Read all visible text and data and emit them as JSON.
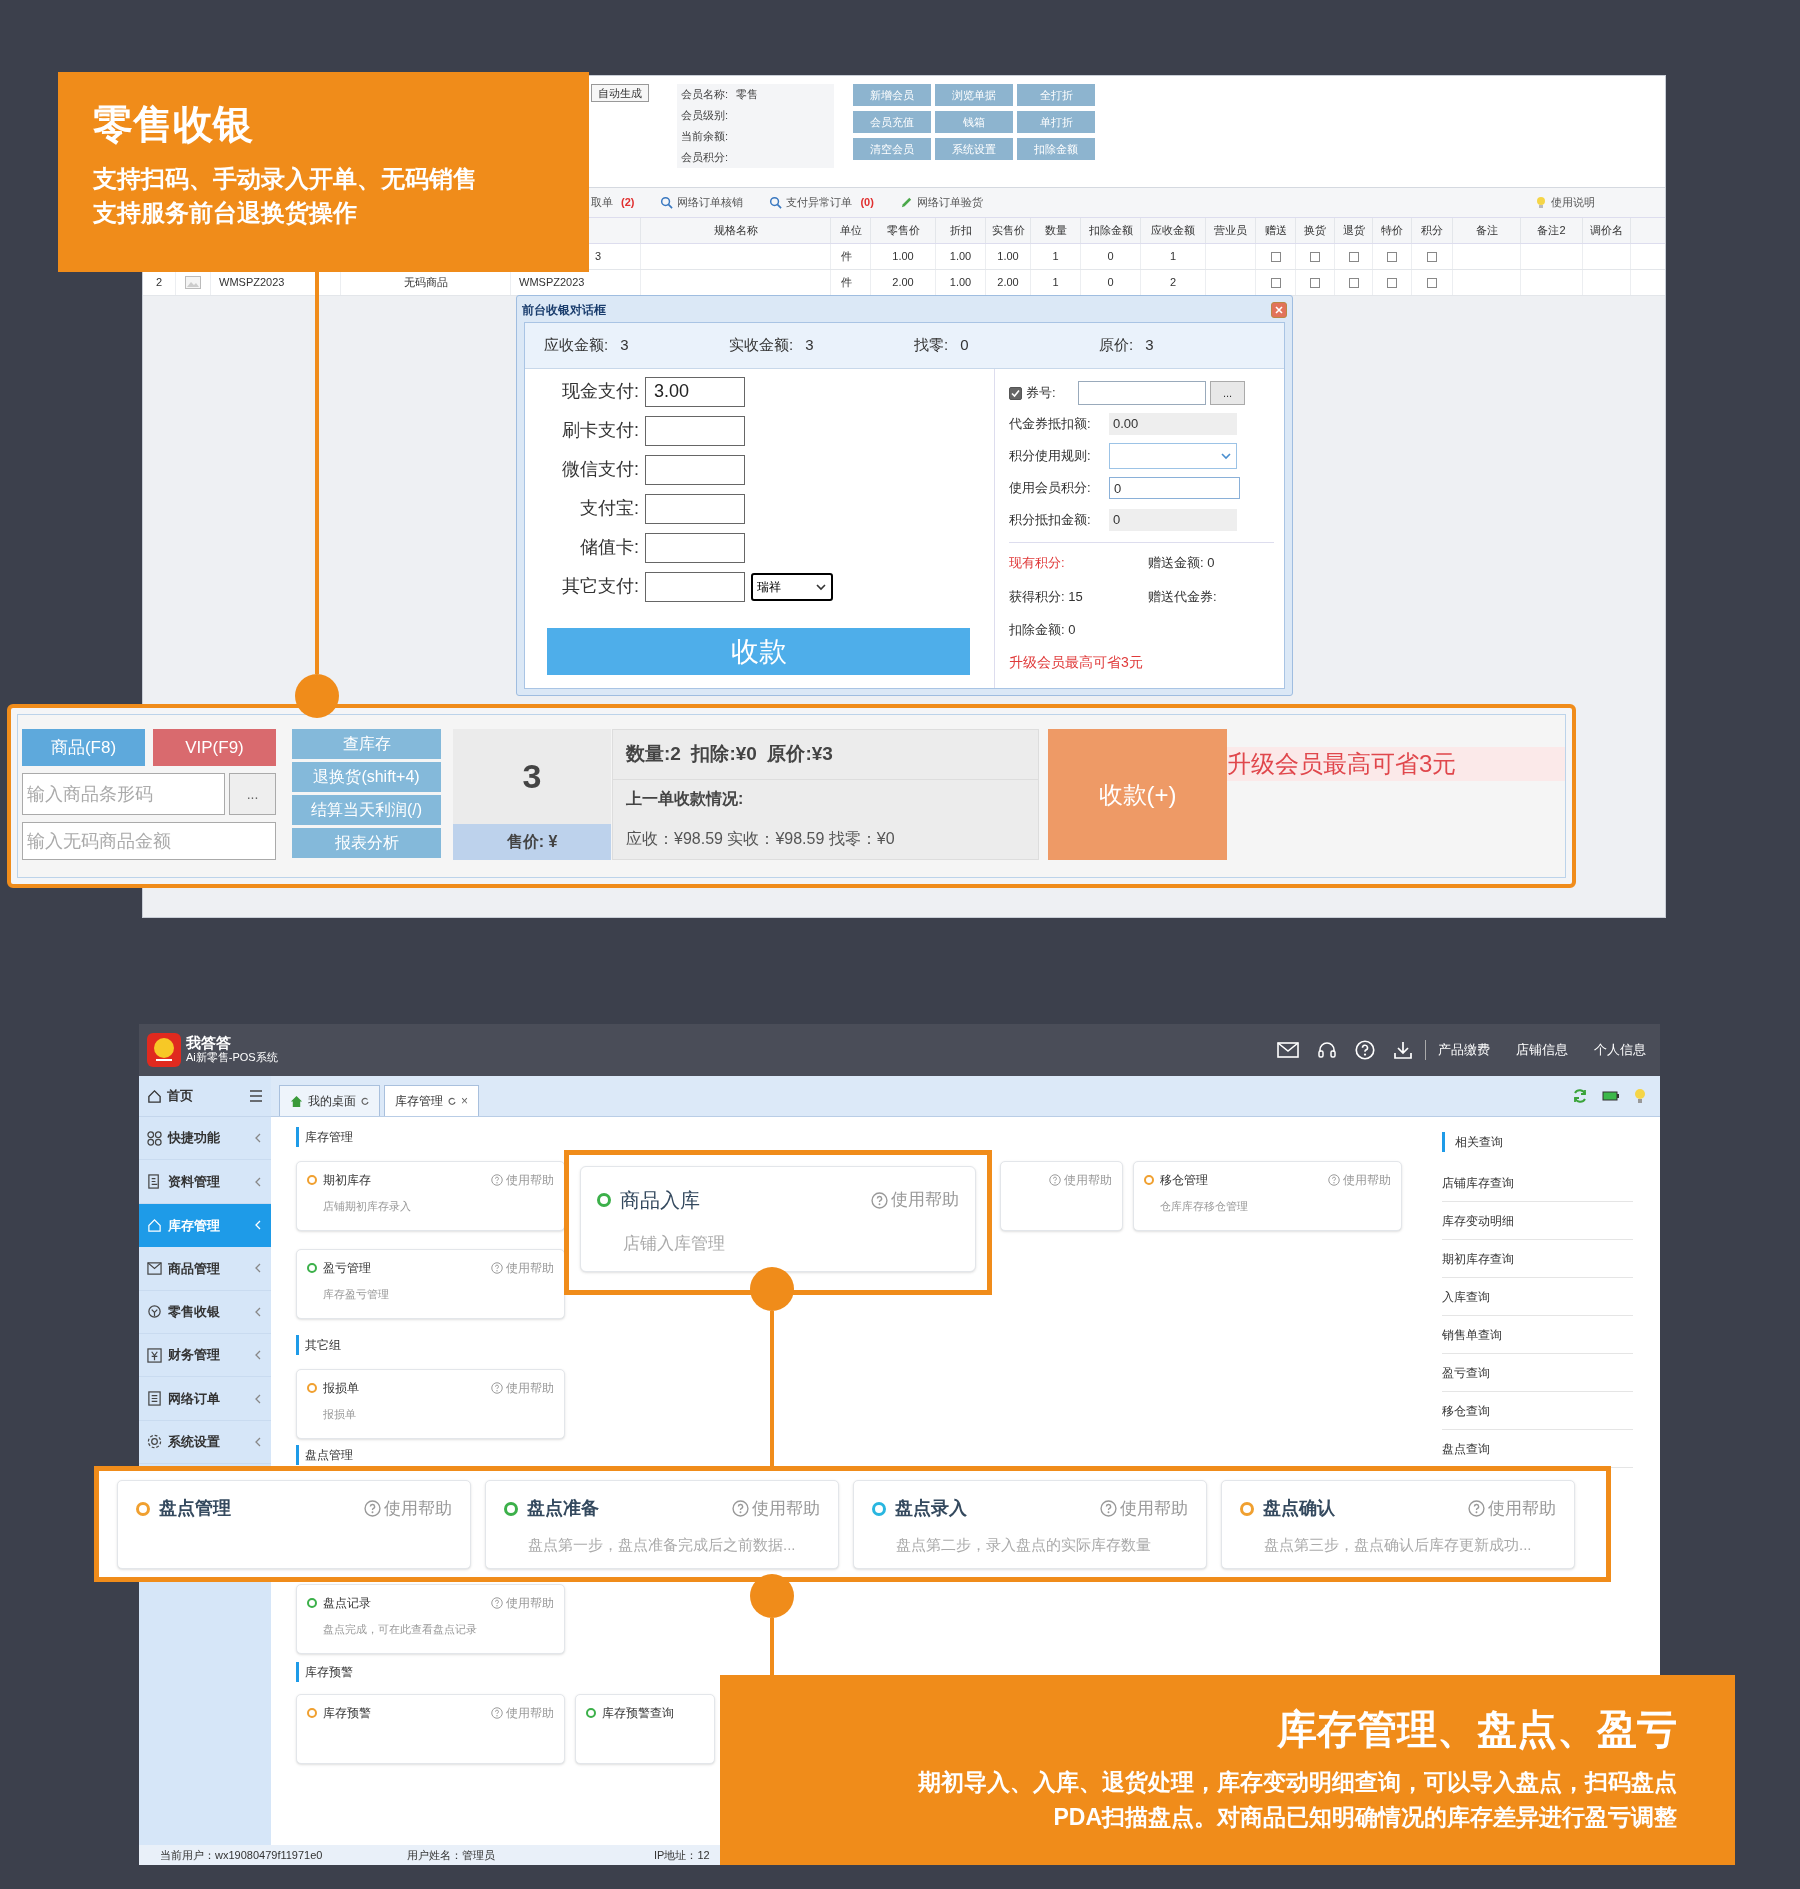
{
  "retail_callout": {
    "title": "零售收银",
    "lines": [
      "支持扫码、手动录入开单、无码销售",
      "支持服务前台退换货操作"
    ]
  },
  "pos_window": {
    "order_button": "自动生成",
    "member_info": [
      {
        "label": "会员名称:",
        "value": "零售"
      },
      {
        "label": "会员级别:"
      },
      {
        "label": "当前余额:"
      },
      {
        "label": "会员积分:"
      }
    ],
    "member_buttons": [
      "新增会员",
      "浏览单据",
      "全打折",
      "会员充值",
      "钱箱",
      "单打折",
      "清空会员",
      "系统设置",
      "扣除金额"
    ],
    "toolbar": [
      {
        "kind": "plain",
        "label": "取单",
        "count": "(2)"
      },
      {
        "kind": "search",
        "label": "网络订单核销"
      },
      {
        "kind": "search",
        "label": "支付异常订单",
        "count": "(0)"
      },
      {
        "kind": "edit",
        "label": "网络订单验货"
      }
    ],
    "help_link": "使用说明",
    "table": {
      "columns": [
        "规格名称",
        "单位",
        "零售价",
        "折扣",
        "实售价",
        "数量",
        "扣除金额",
        "应收金额",
        "营业员",
        "赠送",
        "换货",
        "退货",
        "特价",
        "积分",
        "备注",
        "备注2",
        "调价名"
      ],
      "rows": [
        {
          "barcode": "3",
          "unit": "件",
          "values": [
            "1.00",
            "1.00",
            "1.00",
            "1",
            "0",
            "1"
          ],
          "checks": [
            false,
            false,
            false,
            false,
            false
          ]
        },
        {
          "no": "2",
          "has_image": true,
          "code": "WMSPZ2023",
          "name": "无码商品",
          "barcode": "WMSPZ2023",
          "unit": "件",
          "values": [
            "2.00",
            "1.00",
            "2.00",
            "1",
            "0",
            "2"
          ],
          "checks": [
            false,
            false,
            false,
            false,
            false
          ]
        }
      ]
    }
  },
  "dialog": {
    "title": "前台收银对话框",
    "summary": [
      {
        "label": "应收金额:",
        "value": "3"
      },
      {
        "label": "实收金额:",
        "value": "3"
      },
      {
        "label": "找零:",
        "value": "0"
      },
      {
        "label": "原价:",
        "value": "3"
      }
    ],
    "payments": [
      {
        "label": "现金支付:",
        "value": "3.00"
      },
      {
        "label": "刷卡支付:"
      },
      {
        "label": "微信支付:"
      },
      {
        "label": "支付宝:"
      },
      {
        "label": "储值卡:"
      },
      {
        "label": "其它支付:",
        "option": "瑞祥"
      }
    ],
    "pay_button": "收款",
    "voucher": {
      "checked": true,
      "label": "券号:",
      "browse": "..."
    },
    "fields": [
      {
        "kind": "readonly",
        "label": "代金券抵扣额:",
        "value": "0.00"
      },
      {
        "kind": "select",
        "label": "积分使用规则:"
      },
      {
        "kind": "input",
        "label": "使用会员积分:",
        "value": "0"
      },
      {
        "kind": "readonly",
        "label": "积分抵扣金额:",
        "value": "0"
      }
    ],
    "stats": [
      {
        "text": "现有积分:",
        "highlight": true
      },
      {
        "text": "赠送金额: 0",
        "highlight": false
      },
      {
        "text": "获得积分: 15",
        "highlight": false
      },
      {
        "text": "赠送代金券:",
        "highlight": false
      },
      {
        "text": "扣除金额: 0",
        "highlight": false
      }
    ],
    "promo": "升级会员最高可省3元"
  },
  "checkout_bar": {
    "product_button": "商品(F8)",
    "vip_button": "VIP(F9)",
    "barcode_placeholder": "输入商品条形码",
    "browse": "...",
    "amount_placeholder": "输入无码商品金额",
    "actions": [
      "查库存",
      "退换货(shift+4)",
      "结算当天利润(/)",
      "报表分析"
    ],
    "quantity": "3",
    "price_label": "售价: ¥",
    "summary": "数量:2  扣除:¥0  原价:¥3",
    "last_title": "上一单收款情况:",
    "last_detail": "应收：¥98.59 实收：¥98.59 找零：¥0",
    "checkout_button": "收款(+)",
    "promo": "升级会员最高可省3元"
  },
  "inventory_app": {
    "name": "我答答",
    "subtitle": "Ai新零售-POS系统",
    "header_links": [
      "产品缴费",
      "店铺信息",
      "个人信息"
    ],
    "home": "首页",
    "tabs": [
      {
        "kind": "home",
        "label": "我的桌面",
        "selected": false
      },
      {
        "kind": "page",
        "label": "库存管理",
        "selected": true,
        "close": "×"
      }
    ],
    "sidebar": [
      {
        "label": "快捷功能",
        "selected": false
      },
      {
        "label": "资料管理",
        "selected": false
      },
      {
        "label": "库存管理",
        "selected": true
      },
      {
        "label": "商品管理",
        "selected": false
      },
      {
        "label": "零售收银",
        "selected": false
      },
      {
        "label": "财务管理",
        "selected": false
      },
      {
        "label": "网络订单",
        "selected": false
      },
      {
        "label": "系统设置",
        "selected": false
      }
    ],
    "sections": [
      {
        "title": "库存管理",
        "cards": [
          {
            "kind": "full",
            "title": "期初库存",
            "desc": "店铺期初库存录入",
            "color": "#f0a030",
            "help": "使用帮助"
          },
          {
            "kind": "partial",
            "help": "使用帮助"
          },
          {
            "kind": "full",
            "title": "移仓管理",
            "desc": "仓库库存移仓管理",
            "color": "#f0a030",
            "help": "使用帮助"
          },
          {
            "kind": "full",
            "title": "盈亏管理",
            "desc": "库存盈亏管理",
            "color": "#3cb04a",
            "help": "使用帮助"
          }
        ]
      },
      {
        "title": "其它组",
        "cards": [
          {
            "kind": "full",
            "title": "报损单",
            "desc": "报损单",
            "color": "#f0a030",
            "help": "使用帮助"
          }
        ]
      },
      {
        "title": "盘点管理",
        "cards": [
          {
            "kind": "full",
            "title": "盘点记录",
            "desc": "盘点完成，可在此查看盘点记录",
            "color": "#3cb04a",
            "help": "使用帮助"
          }
        ]
      },
      {
        "title": "库存预警",
        "cards": [
          {
            "kind": "full",
            "title": "库存预警",
            "color": "#f0a030",
            "help": "使用帮助"
          },
          {
            "kind": "clipped",
            "title": "库存预警查询",
            "color": "#3cb04a"
          }
        ]
      }
    ],
    "related": {
      "title": "相关查询",
      "links": [
        "店铺库存查询",
        "库存变动明细",
        "期初库存查询",
        "入库查询",
        "销售单查询",
        "盈亏查询",
        "移仓查询",
        "盘点查询"
      ]
    },
    "status_bar": [
      "当前用户：wx19080479f11971e0",
      "用户姓名：管理员",
      "IP地址：12"
    ]
  },
  "inventory_callouts": {
    "main_card": {
      "title": "商品入库",
      "desc": "店铺入库管理",
      "color": "#3cb04a",
      "help": "使用帮助"
    },
    "count_cards": [
      {
        "title": "盘点管理",
        "color": "#f0a030",
        "help": "使用帮助"
      },
      {
        "title": "盘点准备",
        "desc": "盘点第一步，盘点准备完成后之前数据...",
        "color": "#3cb04a",
        "help": "使用帮助"
      },
      {
        "title": "盘点录入",
        "desc": "盘点第二步，录入盘点的实际库存数量",
        "color": "#29b6e0",
        "help": "使用帮助"
      },
      {
        "title": "盘点确认",
        "desc": "盘点第三步，盘点确认后库存更新成功...",
        "color": "#f0a030",
        "help": "使用帮助"
      }
    ],
    "title": "库存管理、盘点、盈亏",
    "lines": [
      "期初导入、入库、退货处理，库存变动明细查询，可以导入盘点，扫码盘点",
      "PDA扫描盘点。对商品已知明确情况的库存差异进行盈亏调整"
    ]
  }
}
